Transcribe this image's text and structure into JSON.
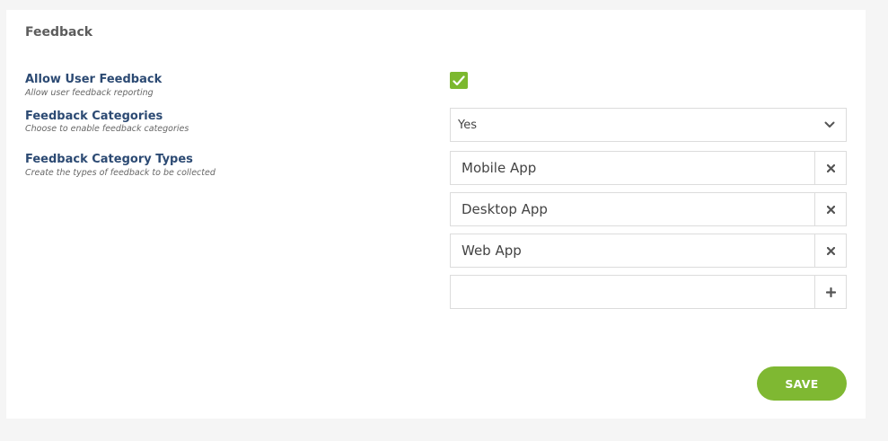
{
  "panel": {
    "title": "Feedback"
  },
  "settings": [
    {
      "label": "Allow User Feedback",
      "description": "Allow user feedback reporting"
    },
    {
      "label": "Feedback Categories",
      "description": "Choose to enable feedback categories"
    },
    {
      "label": "Feedback Category Types",
      "description": "Create the types of feedback to be collected"
    }
  ],
  "allow_feedback": {
    "checked": true,
    "icon": "check-icon"
  },
  "categories_select": {
    "value": "Yes",
    "icon": "chevron-down-icon"
  },
  "category_types": [
    {
      "value": "Mobile App",
      "action_icon": "close-icon"
    },
    {
      "value": "Desktop App",
      "action_icon": "close-icon"
    },
    {
      "value": "Web App",
      "action_icon": "close-icon"
    }
  ],
  "new_type": {
    "value": "",
    "action_icon": "plus-icon"
  },
  "actions": {
    "save_label": "SAVE"
  },
  "colors": {
    "accent": "#7cb82f",
    "label": "#2c4a73"
  }
}
